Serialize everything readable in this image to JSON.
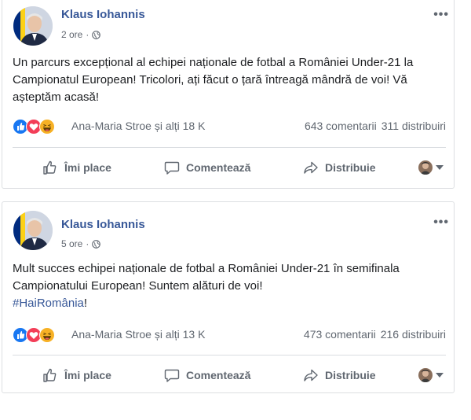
{
  "posts": [
    {
      "author": "Klaus Iohannis",
      "time": "2 ore",
      "separator": "·",
      "text": "Un parcurs excepțional al echipei naționale de fotbal a României Under-21 la Campionatul European! Tricolori, ați făcut o țară întreagă mândră de voi! Vă așteptăm acasă!",
      "hashtag": "",
      "hashtag_suffix": "",
      "reactors": "Ana-Maria Stroe și alți 18 K",
      "comments": "643 comentarii",
      "shares": "311 distribuiri",
      "more": "•••",
      "reactions": [
        "like",
        "love",
        "haha"
      ]
    },
    {
      "author": "Klaus Iohannis",
      "time": "5 ore",
      "separator": "·",
      "text": "Mult succes echipei naționale de fotbal a României Under-21 în semifinala Campionatului European! Suntem alături de voi!",
      "hashtag": "#HaiRomânia",
      "hashtag_suffix": "!",
      "reactors": "Ana-Maria Stroe și alți 13 K",
      "comments": "473 comentarii",
      "shares": "216 distribuiri",
      "more": "•••",
      "reactions": [
        "like",
        "love",
        "haha"
      ]
    }
  ],
  "actions": {
    "like": "Îmi place",
    "comment": "Comentează",
    "share": "Distribuie"
  },
  "colors": {
    "author": "#385898",
    "like": "#1877f2",
    "love": "#f33e58",
    "haha": "#f7b125",
    "flag_blue": "#002b7f",
    "flag_yellow": "#fcd116"
  },
  "icons": {
    "more": "more-options-icon",
    "audience": "globe-icon",
    "like": "thumbs-up-icon",
    "comment": "comment-bubble-icon",
    "share": "share-arrow-icon",
    "viewer": "viewer-avatar-icon"
  }
}
